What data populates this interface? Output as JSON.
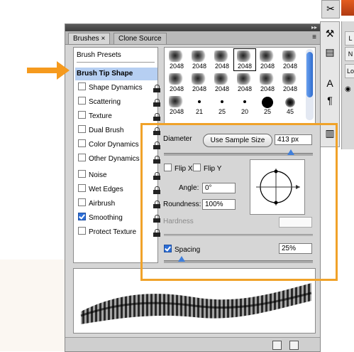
{
  "panel": {
    "tabs": [
      {
        "label": "Brushes ×",
        "active": true
      },
      {
        "label": "Clone Source",
        "active": false
      }
    ],
    "collapse_glyph": "▸▸",
    "menu_glyph": "≡"
  },
  "brush_list": {
    "presets_label": "Brush Presets",
    "tip_shape_label": "Brush Tip Shape",
    "options": [
      {
        "label": "Shape Dynamics",
        "checked": false,
        "locked": true
      },
      {
        "label": "Scattering",
        "checked": false,
        "locked": true
      },
      {
        "label": "Texture",
        "checked": false,
        "locked": true
      },
      {
        "label": "Dual Brush",
        "checked": false,
        "locked": true
      },
      {
        "label": "Color Dynamics",
        "checked": false,
        "locked": true
      },
      {
        "label": "Other Dynamics",
        "checked": false,
        "locked": true
      },
      {
        "label": "Noise",
        "checked": false,
        "locked": true
      },
      {
        "label": "Wet Edges",
        "checked": false,
        "locked": true
      },
      {
        "label": "Airbrush",
        "checked": false,
        "locked": true
      },
      {
        "label": "Smoothing",
        "checked": true,
        "locked": true
      },
      {
        "label": "Protect Texture",
        "checked": false,
        "locked": true
      }
    ]
  },
  "brush_grid": {
    "row1": [
      "2048",
      "2048",
      "2048",
      "2048",
      "2048",
      "2048"
    ],
    "row2": [
      "2048",
      "2048",
      "2048",
      "2048",
      "2048",
      "2048"
    ],
    "row3": [
      "2048",
      "21",
      "25",
      "20",
      "25",
      "45"
    ]
  },
  "tip_shape": {
    "diameter_label": "Diameter",
    "use_sample_size_label": "Use Sample Size",
    "diameter_value": "413 px",
    "diameter_slider_fraction": 0.85,
    "flip_x_label": "Flip X",
    "flip_y_label": "Flip Y",
    "angle_label": "Angle:",
    "angle_value": "0°",
    "roundness_label": "Roundness:",
    "roundness_value": "100%",
    "hardness_label": "Hardness",
    "hardness_value": "",
    "spacing_label": "Spacing",
    "spacing_checked": true,
    "spacing_value": "25%",
    "spacing_slider_fraction": 0.12
  },
  "colors": {
    "highlight": "#f0a229",
    "selection": "#b6cff2",
    "accent_blue": "#3f7fdc"
  },
  "right_dock": {
    "side_tabs": [
      "L",
      "N",
      "Lo"
    ]
  }
}
